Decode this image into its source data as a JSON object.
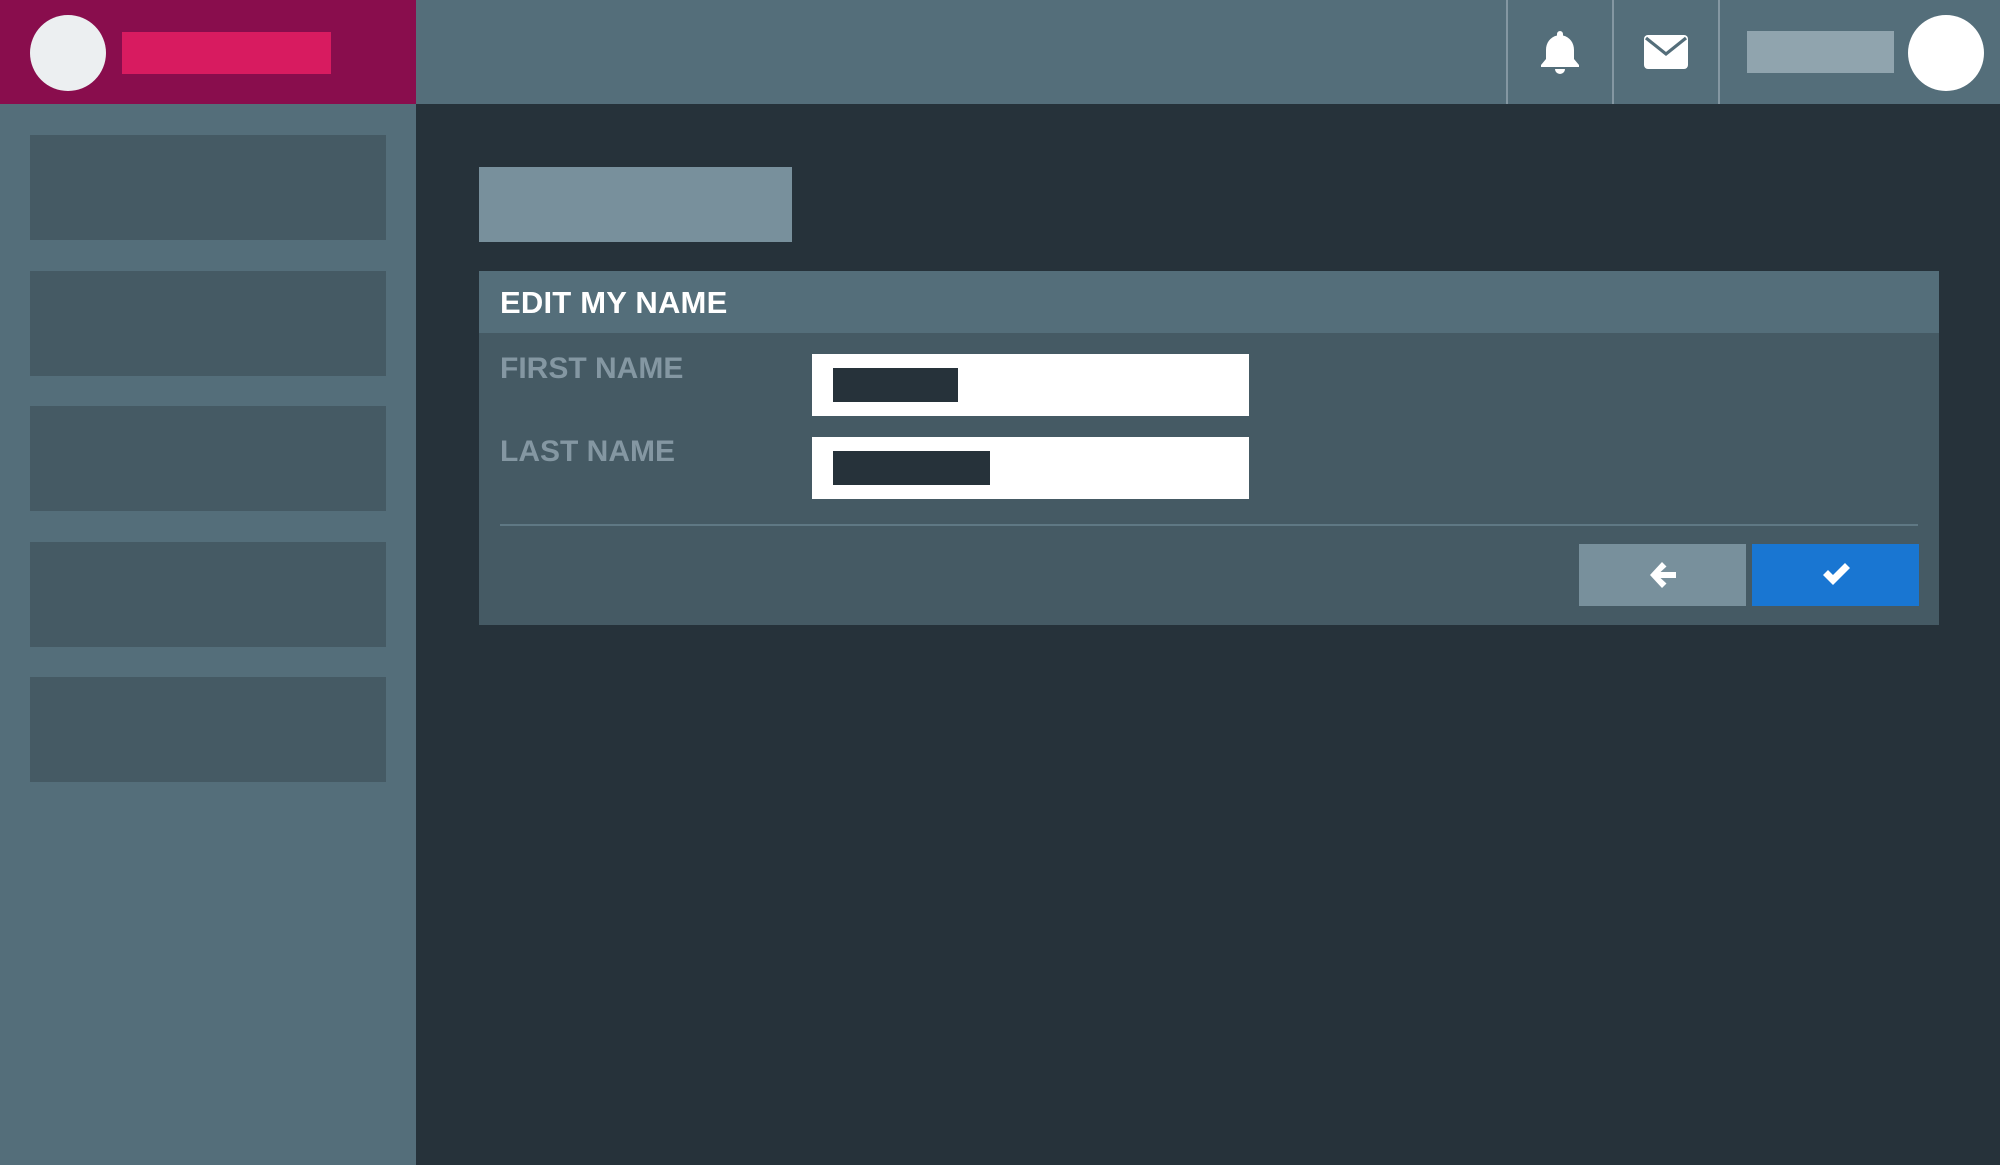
{
  "colors": {
    "brand_bg": "#890d4d",
    "brand_name_bar": "#d81b60",
    "brand_logo": "#eceff1",
    "topbar_bg": "#546e7a",
    "sidebar_bg": "#546e7a",
    "nav_item_bg": "#455a64",
    "main_bg": "#26323a",
    "page_title_bar": "#78909c",
    "panel_bg": "#455a64",
    "panel_header_bg": "#546e7a",
    "panel_title_text": "#ffffff",
    "field_label_text": "#8497a2",
    "input_bg": "#ffffff",
    "input_value_bar": "#26323a",
    "rule": "#5f7884",
    "back_button_bg": "#78909c",
    "confirm_button_bg": "#1976d2",
    "icon_color": "#ffffff",
    "user_name_bar": "#90a4ae",
    "user_avatar": "#ffffff"
  },
  "header": {
    "notifications_icon": "bell-icon",
    "messages_icon": "envelope-icon"
  },
  "sidebar": {
    "item_count": 5
  },
  "panel": {
    "title": "EDIT MY NAME",
    "fields": [
      {
        "label": "FIRST NAME",
        "value_visible": "redacted"
      },
      {
        "label": "LAST NAME",
        "value_visible": "redacted"
      }
    ],
    "back_icon": "arrow-left-icon",
    "confirm_icon": "checkmark-icon"
  }
}
